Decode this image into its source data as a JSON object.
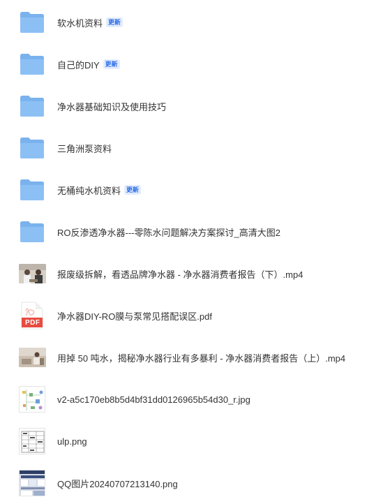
{
  "files": [
    {
      "name": "软水机资料",
      "type": "folder",
      "badge": "更新"
    },
    {
      "name": "自己的DIY",
      "type": "folder",
      "badge": "更新"
    },
    {
      "name": "净水器基础知识及使用技巧",
      "type": "folder",
      "badge": null
    },
    {
      "name": "三角洲泵资料",
      "type": "folder",
      "badge": null
    },
    {
      "name": "无桶纯水机资料",
      "type": "folder",
      "badge": "更新"
    },
    {
      "name": "RO反渗透净水器---零陈水问题解决方案探讨_高清大图2",
      "type": "folder",
      "badge": null
    },
    {
      "name": "报废级拆解，看透品牌净水器 - 净水器消费者报告（下）.mp4",
      "type": "video",
      "badge": null
    },
    {
      "name": "净水器DIY-RO膜与泵常见搭配误区.pdf",
      "type": "pdf",
      "badge": null,
      "icon_label": "PDF"
    },
    {
      "name": "用掉 50 吨水，揭秘净水器行业有多暴利 - 净水器消费者报告（上）.mp4",
      "type": "video",
      "badge": null
    },
    {
      "name": "v2-a5c170eb8b5d4bf31dd0126965b54d30_r.jpg",
      "type": "image",
      "badge": null
    },
    {
      "name": "ulp.png",
      "type": "image",
      "badge": null
    },
    {
      "name": "QQ图片20240707213140.png",
      "type": "image",
      "badge": null
    }
  ],
  "colors": {
    "folder": "#7ab2ee",
    "folder_tab": "#8cc0f5",
    "badge_text": "#2b6de5",
    "badge_bg": "#e3ecfd",
    "pdf_red": "#e84b40"
  }
}
